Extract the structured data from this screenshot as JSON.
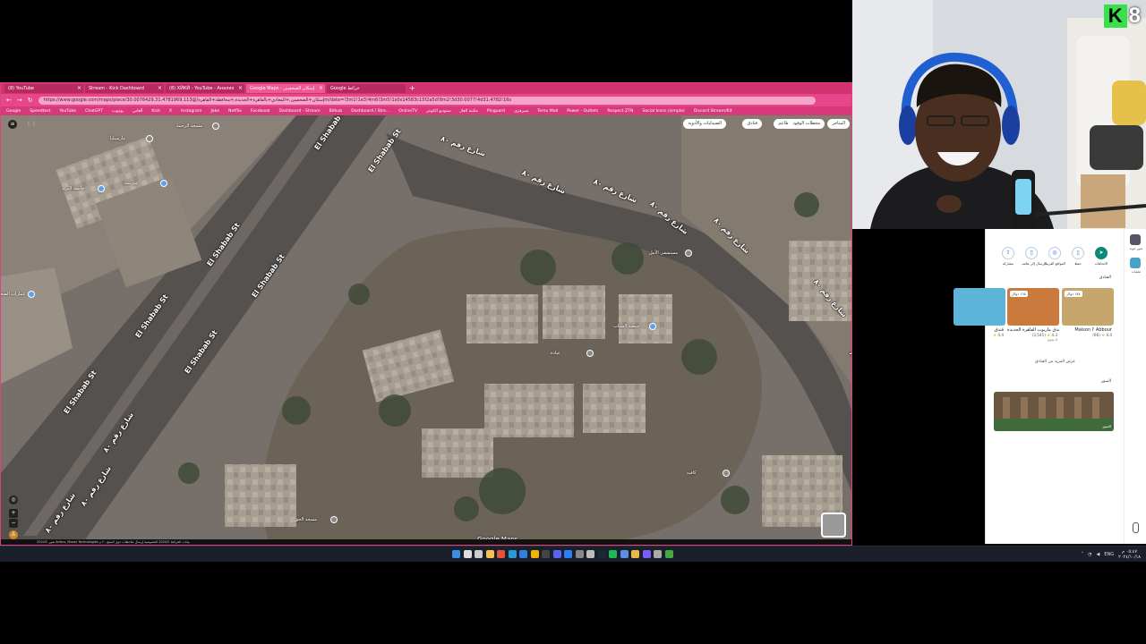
{
  "browser": {
    "tabs": [
      {
        "label": "(8) YouTube",
        "active": false
      },
      {
        "label": "Stream - Kick Dashboard",
        "active": false
      },
      {
        "label": "(8) ХЙКЙ - YouTube - Анализ",
        "active": false
      },
      {
        "label": "Google Maps - إسكان الصحفيين",
        "active": true
      },
      {
        "label": "Google خرائط",
        "active": false
      }
    ],
    "url": "https://www.google.com/maps/place/إسكان+الصحفيين,+المعادي+بالقاهرة+الجديدة,+محافظة+القاهرة/@30.0076429,31.4781969,113m/data=!3m1!1e3!4m6!3m5!1s0x14583c15f2a5d!8m2!3d30.0077!4d31.4782!16s",
    "bookmarks": [
      "Google",
      "Speedtest",
      "YouTube",
      "ChatGPT",
      "يوتيوب",
      "ألعابي",
      "Kick",
      "X",
      "Instagram",
      "Jake",
      "Netflix",
      "Facebook",
      "Dashboard - Stream",
      "Bitkub",
      "Dashboard / Stre...",
      "OnlineTV",
      "ستوديو الكونتر",
      "مكتبة الغاز",
      "Pinguard",
      "سيرفري",
      "Temu Mall",
      "Power - Outlets",
      "Respect ZTN",
      "Social Icons (simple)",
      "Discord Stream/Kit"
    ]
  },
  "map": {
    "chips": [
      "فنادق",
      "مطاعم",
      "محطات الوقود",
      "المتاجر",
      "الصيدليات والأدوية"
    ],
    "road_labels": [
      "El Shabab St",
      "El Shabab St",
      "El Shabab St",
      "El Shabab St",
      "El Shabab St",
      "El Shabab St",
      "El Shabab St",
      "شارع رقم ٨٠",
      "شارع رقم ٨٠",
      "شارع رقم ٨٠",
      "شارع رقم ٨٠",
      "شارع رقم ٨٠",
      "شارع رقم ٨٠",
      "شارع رقم ٨٠",
      "شارع رقم ٨٠",
      "شارع رقم ٨٠",
      "شارع رقم ٨٠",
      "شارع رقم ٨٠"
    ],
    "poi_labels": [
      "مارسيليا",
      "مسجد الرحمة",
      "جامعة البريد",
      "مدرسة",
      "عمارات الصحفيين",
      "مستشفى الأمل",
      "جمعية الشباب",
      "عيادة",
      "ماركت",
      "صيدلية",
      "مطعم",
      "كافيه",
      "مسجد الحق"
    ],
    "logo": "Google Maps",
    "status": "صور ©2024 Airbus, Maxar Technologies  بيانات الخرائط ©2024  الخصوصية  إرسال ملاحظات حول المنتج  ٢٠ م"
  },
  "panel": {
    "rail": [
      {
        "label": "صور جوية"
      },
      {
        "label": "طبقات"
      }
    ],
    "actions": [
      {
        "label": "الاتجاهات",
        "icon": "directions-icon",
        "primary": true
      },
      {
        "label": "حفظ",
        "icon": "bookmark-icon",
        "primary": false
      },
      {
        "label": "المواقع القريبة",
        "icon": "nearby-icon",
        "primary": false
      },
      {
        "label": "الإرسال إلى هاتف",
        "icon": "phone-icon",
        "primary": false
      },
      {
        "label": "مشاركة",
        "icon": "share-icon",
        "primary": false
      }
    ],
    "hotels_title": "الفنادق",
    "hotels": [
      {
        "name": "Maison l' Abbour",
        "price": "١٧٨ دولار",
        "rating": "4.4",
        "reviews": "(66)",
        "sub": "",
        "color": "#c7a66d"
      },
      {
        "name": "فندق ماريوت القاهرة الجديدة",
        "price": "١٦٥ دولار",
        "rating": "4.3",
        "reviews": "(3,541)",
        "sub": "٥ نجوم",
        "color": "#c97a3c"
      },
      {
        "name": "فندق",
        "price": "",
        "rating": "4.4",
        "reviews": "",
        "sub": "",
        "color": "#5cb5d9"
      }
    ],
    "see_more": "عرض المزيد من الفنادق",
    "photos_title": "الصور",
    "photo_caption": "الصور"
  },
  "webcam": {
    "logo_letter": "K",
    "logo_number": "8"
  },
  "taskbar": {
    "icons": [
      "start-icon",
      "search-icon",
      "taskview-icon",
      "file-explorer-icon",
      "office-icon",
      "edge-icon",
      "vscode-icon",
      "chrome-icon",
      "obs-icon",
      "discord-icon",
      "mail-icon",
      "store-icon",
      "settings-icon",
      "steam-icon",
      "spotify-icon",
      "photos-icon",
      "folder-icon",
      "chat-icon",
      "gear-icon",
      "game-icon"
    ],
    "time": "٠٥:٤٧ م",
    "date": "٢٠٢٤/١٠/١٨",
    "lang": "ENG"
  }
}
